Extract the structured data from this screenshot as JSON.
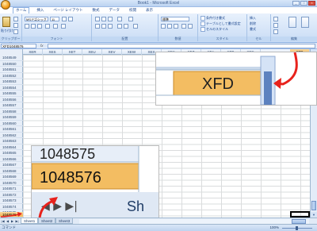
{
  "window": {
    "title": "Book1 - Microsoft Excel",
    "controls": [
      "_",
      "□",
      "×"
    ]
  },
  "ribbon": {
    "tabs": [
      "ホーム",
      "挿入",
      "ページ レイアウト",
      "数式",
      "データ",
      "校閲",
      "表示"
    ],
    "paste_label": "貼り付け",
    "font_name": "MS Pゴシック",
    "font_size": "11",
    "number_format": "標準",
    "styles": [
      "条件付き書式",
      "テーブルとして書式設定",
      "セルのスタイル"
    ],
    "cells": [
      "挿入",
      "削除",
      "書式"
    ],
    "groups": [
      "クリップボード",
      "フォント",
      "配置",
      "数値",
      "スタイル",
      "セル",
      "編集"
    ]
  },
  "formula_bar": {
    "name_box": "XFD1048576",
    "fx": "fx"
  },
  "columns": [
    "XER",
    "XES",
    "XET",
    "XEU",
    "XEV",
    "XEW",
    "XEX",
    "XEY",
    "XEZ",
    "XFA",
    "XFB",
    "XFC",
    "XFD"
  ],
  "active_column": "XFD",
  "rows": [
    "1048549",
    "1048550",
    "1048551",
    "1048552",
    "1048553",
    "1048554",
    "1048555",
    "1048556",
    "1048557",
    "1048558",
    "1048559",
    "1048560",
    "1048561",
    "1048562",
    "1048563",
    "1048564",
    "1048565",
    "1048566",
    "1048567",
    "1048568",
    "1048569",
    "1048570",
    "1048571",
    "1048572",
    "1048573",
    "1048574",
    "1048575",
    "1048576"
  ],
  "active_row": "1048576",
  "sheets": [
    "Sheet1",
    "Sheet2",
    "Sheet3"
  ],
  "status": {
    "left": "コマンド",
    "zoom": "100%"
  },
  "zoom_callouts": {
    "column_label": "XFD",
    "row_prev": "1048575",
    "row_last": "1048576",
    "tab_fragment": "Sh"
  },
  "colors": {
    "highlight": "#F6C770",
    "arrow": "#E8221C",
    "accent": "#15428B"
  }
}
